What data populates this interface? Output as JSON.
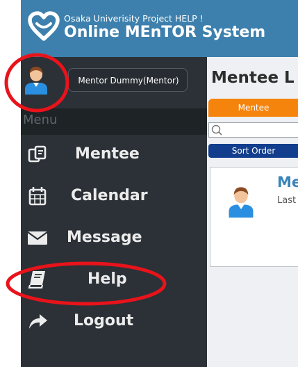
{
  "header": {
    "subtitle": "Osaka Univerisity Project HELP !",
    "title": "Online MEnTOR System"
  },
  "user": {
    "name": "Mentor Dummy(Mentor)"
  },
  "menu": {
    "label": "Menu",
    "items": [
      {
        "label": "Mentee",
        "icon": "mentee-icon"
      },
      {
        "label": "Calendar",
        "icon": "calendar-icon"
      },
      {
        "label": "Message",
        "icon": "envelope-icon"
      },
      {
        "label": "Help",
        "icon": "book-icon"
      },
      {
        "label": "Logout",
        "icon": "share-arrow-icon"
      }
    ]
  },
  "main": {
    "title": "Mentee L",
    "tab_label": "Mentee",
    "search_placeholder": "",
    "sort_label": "Sort Order",
    "card": {
      "name": "Me",
      "subtitle": "Last"
    }
  },
  "colors": {
    "header": "#3d80ad",
    "sidebar": "#2b3136",
    "tab": "#f5840d",
    "sort_button": "#123e8d",
    "annotation": "#e8131b"
  }
}
